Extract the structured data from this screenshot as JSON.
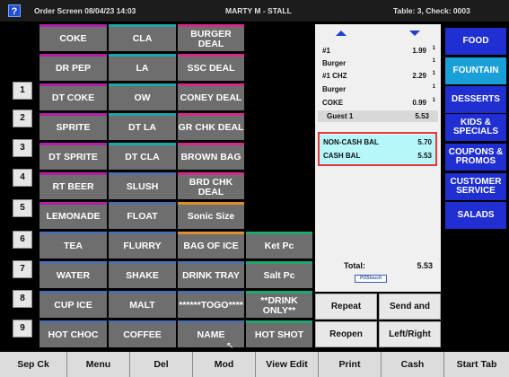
{
  "topbar": {
    "help": "?",
    "screen": "Order Screen 08/04/23 14:03",
    "user": "MARTY M - STALL",
    "table": "Table:  3, Check: 0003"
  },
  "numbers": [
    "1",
    "2",
    "3",
    "4",
    "5",
    "6",
    "7",
    "8",
    "9"
  ],
  "items": {
    "col1": [
      "COKE",
      "DR PEP",
      "DT COKE",
      "SPRITE",
      "DT SPRITE",
      "RT BEER",
      "LEMONADE",
      "TEA",
      "WATER",
      "CUP ICE",
      "HOT CHOC"
    ],
    "col2": [
      "CLA",
      "LA",
      "OW",
      "DT LA",
      "DT CLA",
      "SLUSH",
      "FLOAT",
      "FLURRY",
      "SHAKE",
      "MALT",
      "COFFEE"
    ],
    "col3": [
      "BURGER DEAL",
      "SSC DEAL",
      "CONEY DEAL",
      "GR CHK DEAL",
      "BROWN BAG",
      "BRD CHK DEAL",
      "Sonic Size",
      "BAG OF ICE",
      "DRINK TRAY",
      "******TOGO****",
      "NAME"
    ],
    "col4": [
      "Ket Pc",
      "Salt Pc",
      "**DRINK ONLY**",
      "HOT SHOT"
    ]
  },
  "order": {
    "lines": [
      {
        "name": "#1",
        "price": "1.99",
        "qty": "1"
      },
      {
        "name": "Burger",
        "price": "",
        "qty": "1"
      },
      {
        "name": "#1 CHZ",
        "price": "2.29",
        "qty": "1"
      },
      {
        "name": "Burger",
        "price": "",
        "qty": "1"
      },
      {
        "name": "COKE",
        "price": "0.99",
        "qty": "1"
      }
    ],
    "guest_label": "Guest 1",
    "guest_total": "5.53",
    "noncash_label": "NON-CASH BAL",
    "noncash_value": "5.70",
    "cash_label": "CASH BAL",
    "cash_value": "5.53",
    "total_label": "Total:",
    "total_value": "5.53",
    "logo": "POStouch"
  },
  "actions": {
    "repeat": "Repeat",
    "send": "Send and",
    "reopen": "Reopen",
    "leftright": "Left/Right"
  },
  "categories": [
    "FOOD",
    "FOUNTAIN",
    "DESSERTS",
    "KIDS & SPECIALS",
    "COUPONS & PROMOS",
    "CUSTOMER SERVICE",
    "SALADS"
  ],
  "bottom": [
    "Sep Ck",
    "Menu",
    "Del",
    "Mod",
    "View Edit",
    "Print",
    "Cash",
    "Start Tab"
  ],
  "colors": {
    "category": "#1f2fd1",
    "category_active": "#1aa0d8",
    "balance_bg": "#b6f7fb",
    "highlight_box": "#e03a3a",
    "item_bg": "#6e6e6e"
  }
}
